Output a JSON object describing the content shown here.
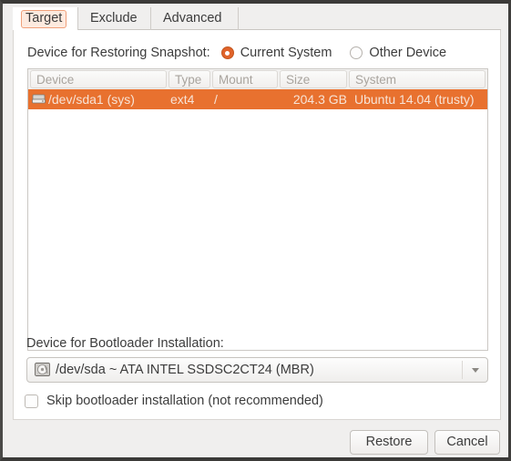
{
  "window": {
    "accent_color": "#e8712f",
    "focus_ring_color": "#f0a07a"
  },
  "tabs": [
    {
      "label": "Target",
      "active": true
    },
    {
      "label": "Exclude",
      "active": false
    },
    {
      "label": "Advanced",
      "active": false
    }
  ],
  "restore_target": {
    "label": "Device for Restoring Snapshot:",
    "options": [
      {
        "label": "Current System",
        "selected": true
      },
      {
        "label": "Other Device",
        "selected": false
      }
    ]
  },
  "device_list": {
    "columns": [
      "Device",
      "Type",
      "Mount",
      "Size",
      "System"
    ],
    "rows": [
      {
        "icon": "disk-icon",
        "device": "/dev/sda1 (sys)",
        "type": "ext4",
        "mount": "/",
        "size": "204.3 GB",
        "system": "Ubuntu 14.04 (trusty)",
        "selected": true
      }
    ]
  },
  "bootloader": {
    "label": "Device for Bootloader Installation:",
    "selected": "/dev/sda ~ ATA INTEL SSDSC2CT24 (MBR)",
    "icon": "hard-drive-icon",
    "skip": {
      "label": "Skip bootloader installation (not recommended)",
      "checked": false
    }
  },
  "footer": {
    "restore_label": "Restore",
    "cancel_label": "Cancel"
  }
}
